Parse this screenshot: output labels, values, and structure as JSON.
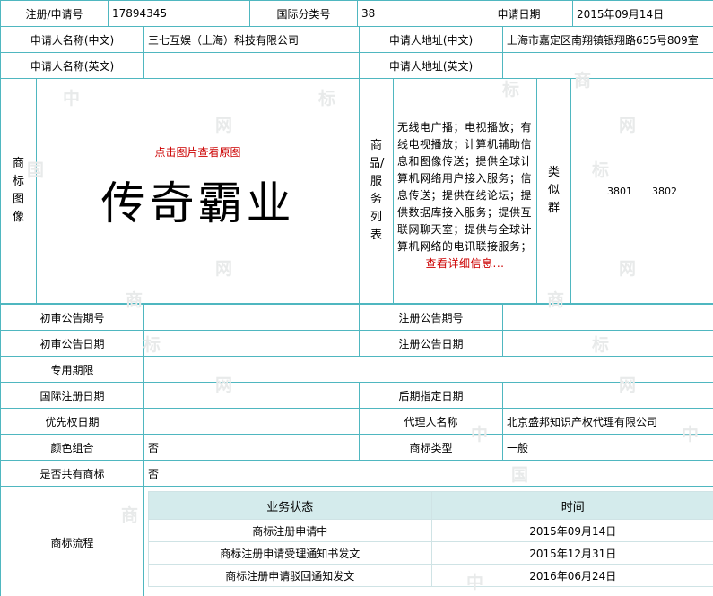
{
  "row1": {
    "reg_no_label": "注册/申请号",
    "reg_no": "17894345",
    "intl_class_label": "国际分类号",
    "intl_class": "38",
    "apply_date_label": "申请日期",
    "apply_date": "2015年09月14日"
  },
  "applicant": {
    "name_cn_label": "申请人名称(中文)",
    "name_cn": "三七互娱（上海）科技有限公司",
    "addr_cn_label": "申请人地址(中文)",
    "addr_cn": "上海市嘉定区南翔镇银翔路655号809室",
    "name_en_label": "申请人名称(英文)",
    "name_en": "",
    "addr_en_label": "申请人地址(英文)",
    "addr_en": ""
  },
  "mark": {
    "image_label": "商标图像",
    "click_view": "点击图片查看原图",
    "mark_text": "传奇霸业",
    "goods_label": "商品/服务列表",
    "goods_text": "无线电广播；电视播放；有线电视播放；计算机辅助信息和图像传送；提供全球计算机网络用户接入服务；信息传送；提供在线论坛；提供数据库接入服务；提供互联网聊天室；提供与全球计算机网络的电讯联接服务；",
    "view_detail": "查看详细信息...",
    "similar_label": "类似群",
    "similar_groups": "3801　　3802"
  },
  "notice": {
    "prelim_no_label": "初审公告期号",
    "prelim_no": "",
    "reg_notice_no_label": "注册公告期号",
    "reg_notice_no": "",
    "prelim_date_label": "初审公告日期",
    "prelim_date": "",
    "reg_notice_date_label": "注册公告日期",
    "reg_notice_date": "",
    "exclusive_label": "专用期限",
    "exclusive": "",
    "intl_reg_date_label": "国际注册日期",
    "intl_reg_date": "",
    "later_date_label": "后期指定日期",
    "later_date": "",
    "priority_label": "优先权日期",
    "priority": "",
    "agent_label": "代理人名称",
    "agent": "北京盛邦知识产权代理有限公司",
    "color_label": "颜色组合",
    "color": "否",
    "type_label": "商标类型",
    "type": "一般",
    "shared_label": "是否共有商标",
    "shared": "否"
  },
  "flow": {
    "label": "商标流程",
    "status_header": "业务状态",
    "time_header": "时间",
    "rows": [
      {
        "status": "商标注册申请中",
        "time": "2015年09月14日"
      },
      {
        "status": "商标注册申请受理通知书发文",
        "time": "2015年12月31日"
      },
      {
        "status": "商标注册申请驳回通知发文",
        "time": "2016年06月24日"
      }
    ]
  },
  "watermark": [
    "中",
    "标",
    "网",
    "商",
    "标",
    "中",
    "国",
    "商"
  ]
}
